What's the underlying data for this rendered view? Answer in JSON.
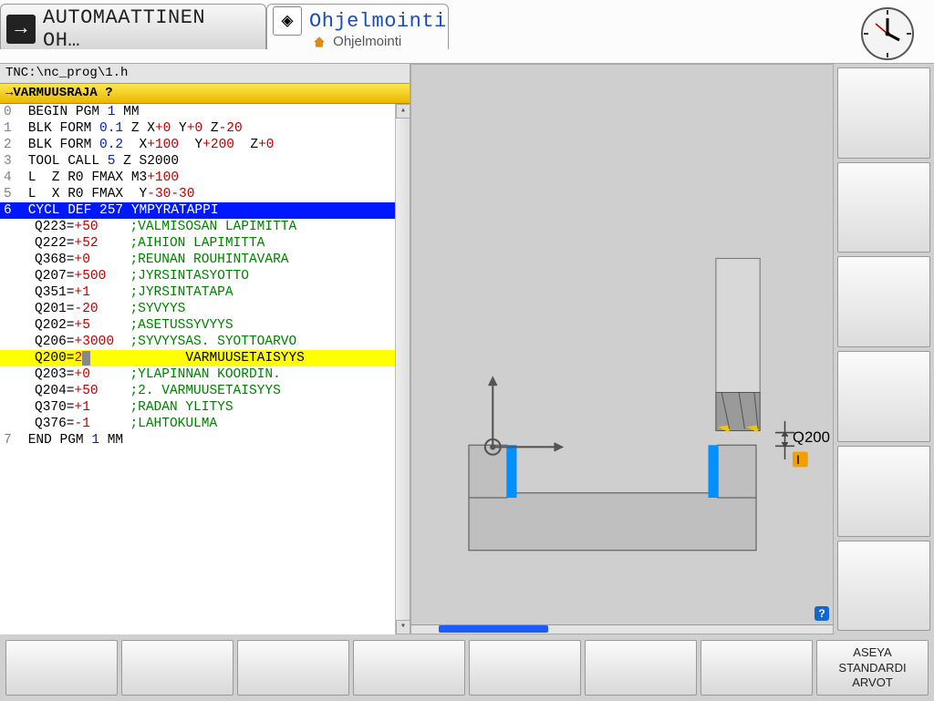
{
  "tabs": {
    "inactive": {
      "label": "AUTOMAATTINEN OH…"
    },
    "active": {
      "label": "Ohjelmointi",
      "crumb": "Ohjelmointi"
    }
  },
  "editor": {
    "path": "TNC:\\nc_prog\\1.h",
    "prompt": "→VARMUUSRAJA ?",
    "graphic_label": "Q200"
  },
  "code": [
    {
      "n": "0",
      "raw": "BEGIN PGM ",
      "blue": "1",
      "tail": " MM"
    },
    {
      "n": "1",
      "raw": "BLK FORM ",
      "blue": "0.1",
      "tail2": " Z X",
      "red": "+0",
      "tail3": " Y",
      "red2": "+0",
      "tail4": " Z",
      "red3": "-20"
    },
    {
      "n": "2",
      "raw": "BLK FORM ",
      "blue": "0.2",
      "tail2": "  X",
      "red": "+100",
      "tail3": "  Y",
      "red2": "+200",
      "tail4": "  Z",
      "red3": "+0"
    },
    {
      "n": "3",
      "raw": "TOOL CALL ",
      "blue": "5",
      "tail": " Z S2000"
    },
    {
      "n": "4",
      "raw": "L  Z",
      "red": "+100",
      "tail": " R0 FMAX M3"
    },
    {
      "n": "5",
      "raw": "L  X",
      "red": "-30",
      "tail2": "  Y",
      "red2": "-30",
      "tail": " R0 FMAX"
    },
    {
      "n": "6",
      "raw": "CYCL DEF 257 YMPYRATAPPI",
      "sel": true
    },
    {
      "p": "Q223=",
      "red": "+50",
      "cmt": ";VALMISOSAN LAPIMITTA"
    },
    {
      "p": "Q222=",
      "red": "+52",
      "cmt": ";AIHION LAPIMITTA"
    },
    {
      "p": "Q368=",
      "red": "+0",
      "cmt": ";REUNAN ROUHINTAVARA"
    },
    {
      "p": "Q207=",
      "red": "+500",
      "cmt": ";JYRSINTASYOTTO"
    },
    {
      "p": "Q351=",
      "red": "+1",
      "cmt": ";JYRSINTATAPA"
    },
    {
      "p": "Q201=",
      "red": "-20",
      "cmt": ";SYVYYS"
    },
    {
      "p": "Q202=",
      "red": "+5",
      "cmt": ";ASETUSSYVYYS"
    },
    {
      "p": "Q206=",
      "red": "+3000",
      "cmt": ";SYVYYSAS. SYOTTOARVO"
    },
    {
      "p": "Q200=",
      "red": "2",
      "cmt": "VARMUUSETAISYYS",
      "hl": true,
      "cursor": true
    },
    {
      "p": "Q203=",
      "red": "+0",
      "cmt": ";YLAPINNAN KOORDIN."
    },
    {
      "p": "Q204=",
      "red": "+50",
      "cmt": ";2. VARMUUSETAISYYS"
    },
    {
      "p": "Q370=",
      "red": "+1",
      "cmt": ";RADAN YLITYS"
    },
    {
      "p": "Q376=",
      "red": "-1",
      "cmt": ";LAHTOKULMA"
    },
    {
      "n": "7",
      "raw": "END PGM ",
      "blue": "1",
      "tail": " MM"
    }
  ],
  "softkeys_bottom": [
    "",
    "",
    "",
    "",
    "",
    "",
    "",
    "ASEYA\nSTANDARDI\nARVOT"
  ]
}
